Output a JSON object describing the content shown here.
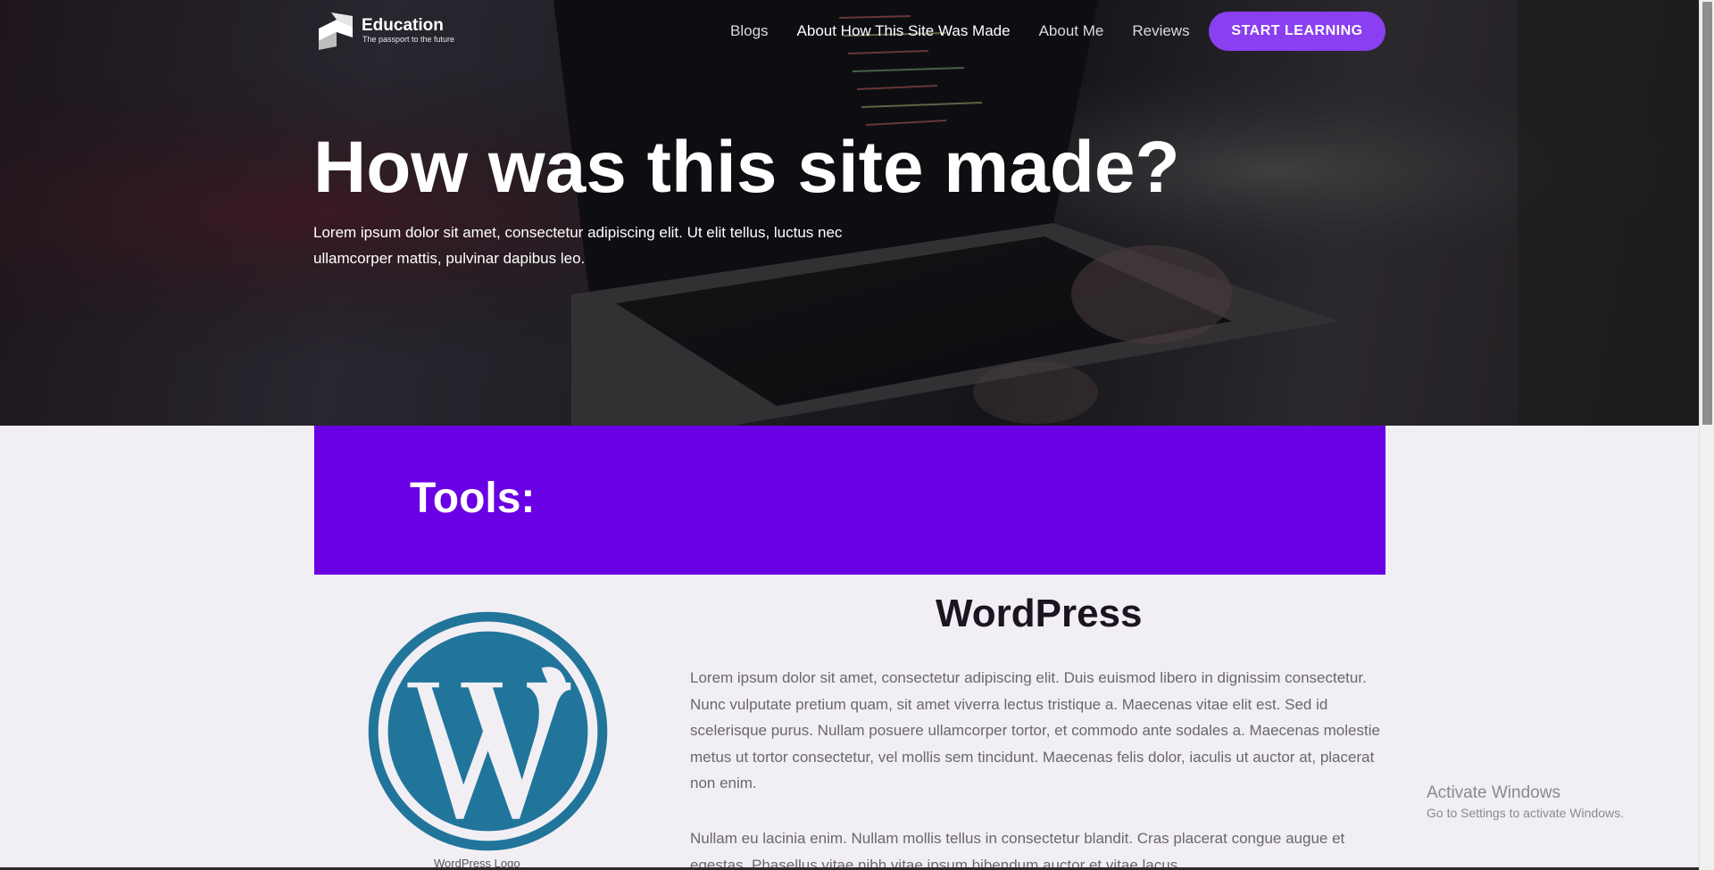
{
  "brand": {
    "name": "Education",
    "tagline": "The passport to the future"
  },
  "nav": {
    "items": [
      {
        "label": "Blogs",
        "active": false
      },
      {
        "label": "About How This Site Was Made",
        "active": true
      },
      {
        "label": "About Me",
        "active": false
      },
      {
        "label": "Reviews",
        "active": false
      }
    ],
    "cta_label": "START LEARNING"
  },
  "hero": {
    "title": "How was this site made?",
    "subtitle": "Lorem ipsum dolor sit amet, consectetur adipiscing elit. Ut elit tellus, luctus nec ullamcorper mattis, pulvinar dapibus leo."
  },
  "tools": {
    "title": "Tools:"
  },
  "wordpress": {
    "heading": "WordPress",
    "caption": "WordPress Logo",
    "paragraph1": "Lorem ipsum dolor sit amet, consectetur adipiscing elit. Duis euismod libero in dignissim consectetur. Nunc vulputate pretium quam, sit amet viverra lectus tristique a. Maecenas vitae elit est. Sed id scelerisque purus. Nullam posuere ullamcorper tortor, et commodo ante sodales a. Maecenas molestie metus ut tortor consectetur, vel mollis sem tincidunt. Maecenas felis dolor, iaculis ut auctor at, placerat non enim.",
    "paragraph2": "Nullam eu lacinia enim. Nullam mollis tellus in consectetur blandit. Cras placerat congue augue et egestas. Phasellus vitae nibh vitae ipsum bibendum auctor et vitae lacus."
  },
  "watermark": {
    "title": "Activate Windows",
    "subtitle": "Go to Settings to activate Windows."
  },
  "colors": {
    "accent": "#8a3ff0",
    "banner": "#6a00e4",
    "wp_blue": "#21759b",
    "page_bg": "#f1eff3"
  },
  "icons": {
    "logo": "education-logo-icon",
    "wordpress": "wordpress-logo-icon"
  }
}
